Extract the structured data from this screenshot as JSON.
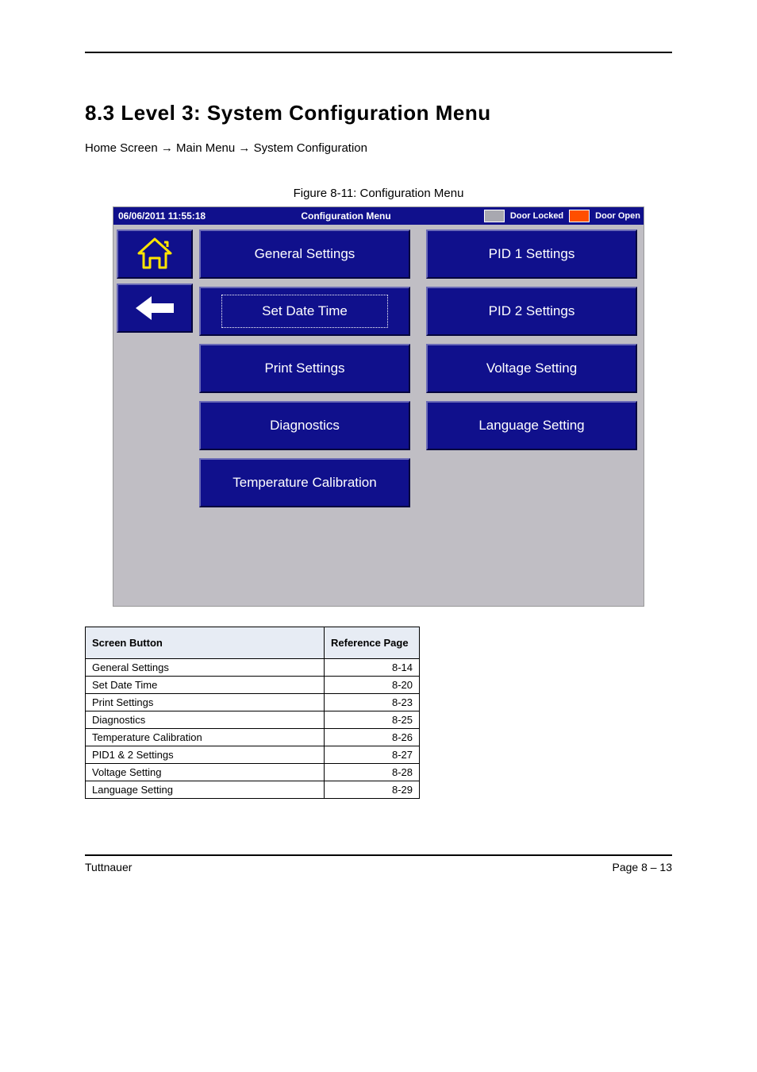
{
  "heading": "8.3 Level 3: System Configuration Menu",
  "breadcrumb": "Home Screen → Main Menu → System Configuration",
  "figure_label": "Figure 8-11: Configuration Menu",
  "screen": {
    "datetime": "06/06/2011 11:55:18",
    "title": "Configuration Menu",
    "status_locked": "Door Locked",
    "status_open": "Door Open",
    "colors": {
      "panel_bg": "#c0bec4",
      "button_bg": "#10108c",
      "indicator_grey": "#a8a8b0",
      "indicator_orange": "#ff4f00"
    },
    "left_col": [
      "General Settings",
      "Set Date Time",
      "Print Settings",
      "Diagnostics",
      "Temperature Calibration"
    ],
    "right_col": [
      "PID 1  Settings",
      "PID 2  Settings",
      "Voltage Setting",
      "Language Setting"
    ],
    "active_index": 1
  },
  "table": {
    "headers": [
      "Screen Button",
      "Reference Page"
    ],
    "rows": [
      [
        "General Settings",
        "8-14"
      ],
      [
        "Set Date Time",
        "8-20"
      ],
      [
        "Print Settings",
        "8-23"
      ],
      [
        "Diagnostics",
        "8-25"
      ],
      [
        "Temperature Calibration",
        "8-26"
      ],
      [
        "PID1 & 2 Settings",
        "8-27"
      ],
      [
        "Voltage Setting",
        "8-28"
      ],
      [
        "Language Setting",
        "8-29"
      ]
    ]
  },
  "footer": {
    "left": "Tuttnauer",
    "right": "Page 8 – 13"
  }
}
